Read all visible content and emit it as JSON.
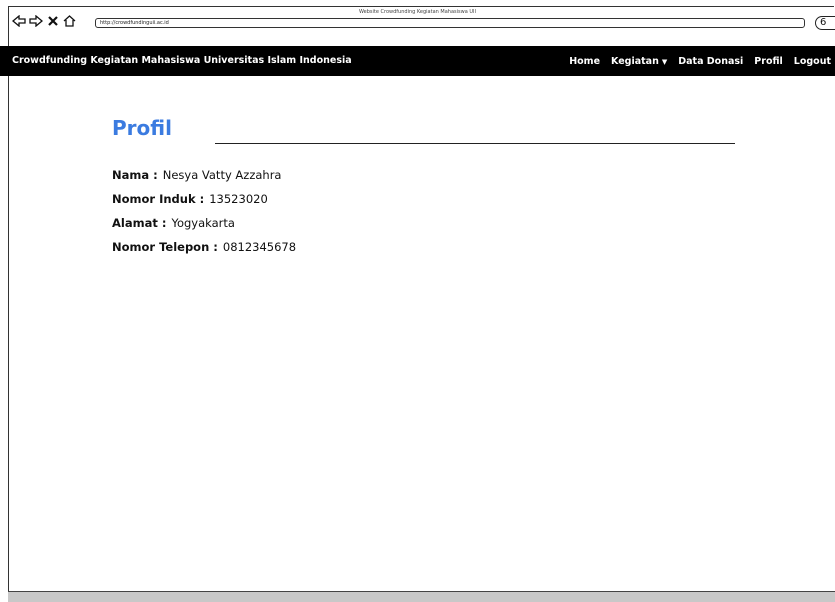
{
  "browser": {
    "window_title": "Website Crowdfunding Kegiatan Mahasiswa UII",
    "url": "http://crowdfundinguii.ac.id",
    "icons": {
      "back": "back-arrow-icon",
      "forward": "forward-arrow-icon",
      "stop": "stop-icon",
      "home": "home-icon",
      "profile": "profile-icon"
    },
    "profile_glyph": "6"
  },
  "navbar": {
    "brand": "Crowdfunding Kegiatan Mahasiswa Universitas Islam Indonesia",
    "items": [
      {
        "label": "Home"
      },
      {
        "label": "Kegiatan"
      },
      {
        "label": "Data Donasi"
      },
      {
        "label": "Profil"
      },
      {
        "label": "Logout"
      }
    ],
    "background": "#000000",
    "text_color": "#ffffff"
  },
  "page": {
    "title": "Profil",
    "title_color": "#3b7be0",
    "fields": [
      {
        "label": "Nama :",
        "value": "Nesya Vatty Azzahra"
      },
      {
        "label": "Nomor Induk :",
        "value": "13523020"
      },
      {
        "label": "Alamat :",
        "value": "Yogyakarta"
      },
      {
        "label": "Nomor Telepon :",
        "value": "0812345678"
      }
    ]
  }
}
